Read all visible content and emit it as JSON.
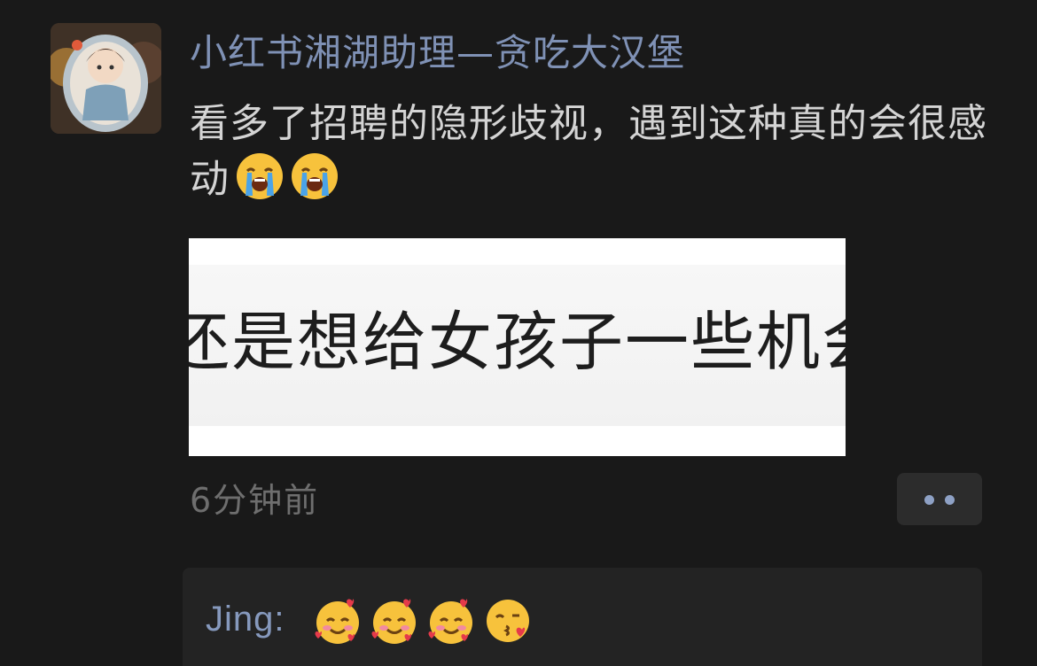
{
  "post": {
    "author": "小红书湘湖助理—贪吃大汉堡",
    "text": "看多了招聘的隐形歧视，遇到这种真的会很感动",
    "text_emojis": [
      "loudly-crying-face",
      "loudly-crying-face"
    ],
    "image_text": "还是想给女孩子一些机会",
    "timestamp": "6分钟前"
  },
  "comment": {
    "author": "Jing",
    "separator": ":",
    "emojis": [
      "smiling-face-with-hearts",
      "smiling-face-with-hearts",
      "smiling-face-with-hearts",
      "face-blowing-a-kiss"
    ]
  },
  "colors": {
    "background": "#191919",
    "name_link": "#7f91b5",
    "body_text": "#d4d4d4",
    "muted_text": "#6e6e6e"
  }
}
